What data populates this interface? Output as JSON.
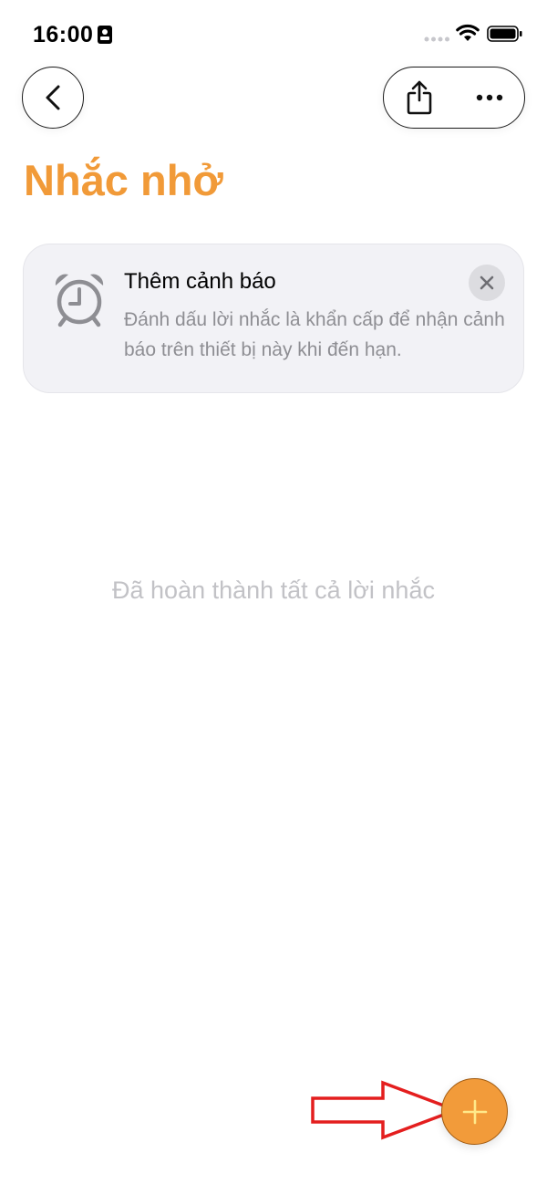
{
  "status_bar": {
    "time": "16:00"
  },
  "nav": {
    "back_icon": "chevron-left-icon",
    "share_icon": "share-icon",
    "more_icon": "ellipsis-icon"
  },
  "page": {
    "title": "Nhắc nhở"
  },
  "alert_card": {
    "icon": "alarm-clock-icon",
    "title": "Thêm cảnh báo",
    "description": "Đánh dấu lời nhắc là khẩn cấp để nhận cảnh báo trên thiết bị này khi đến hạn."
  },
  "empty_state": {
    "message": "Đã hoàn thành tất cả lời nhắc"
  },
  "add_button": {
    "icon": "plus-icon"
  },
  "colors": {
    "accent": "#f19a38",
    "annotation": "#e41e1e"
  }
}
